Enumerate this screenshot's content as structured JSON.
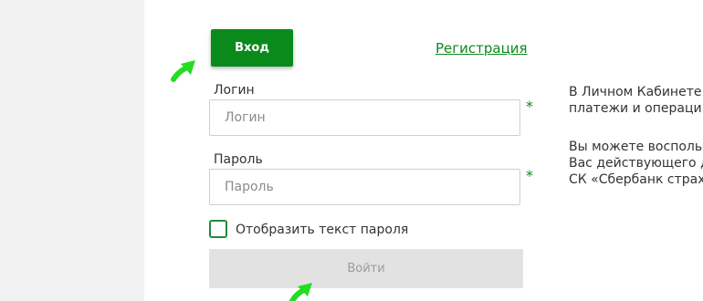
{
  "tabs": {
    "login": "Вход",
    "register": "Регистрация"
  },
  "form": {
    "login_label": "Логин",
    "login_placeholder": "Логин",
    "password_label": "Пароль",
    "password_placeholder": "Пароль",
    "required_mark": "*",
    "show_password_label": "Отобразить текст пароля",
    "show_password_checked": false,
    "submit_label": "Войти"
  },
  "info": {
    "line1": "В Личном Кабинете",
    "line2": "платежи и операци",
    "line3": "Вы можете восполь",
    "line4": "Вас действующего д",
    "line5": "СК «Сбербанк страх"
  },
  "colors": {
    "accent": "#0b8a1c",
    "pointer_arrow": "#22dd22",
    "disabled_button": "#e2e2e2"
  }
}
